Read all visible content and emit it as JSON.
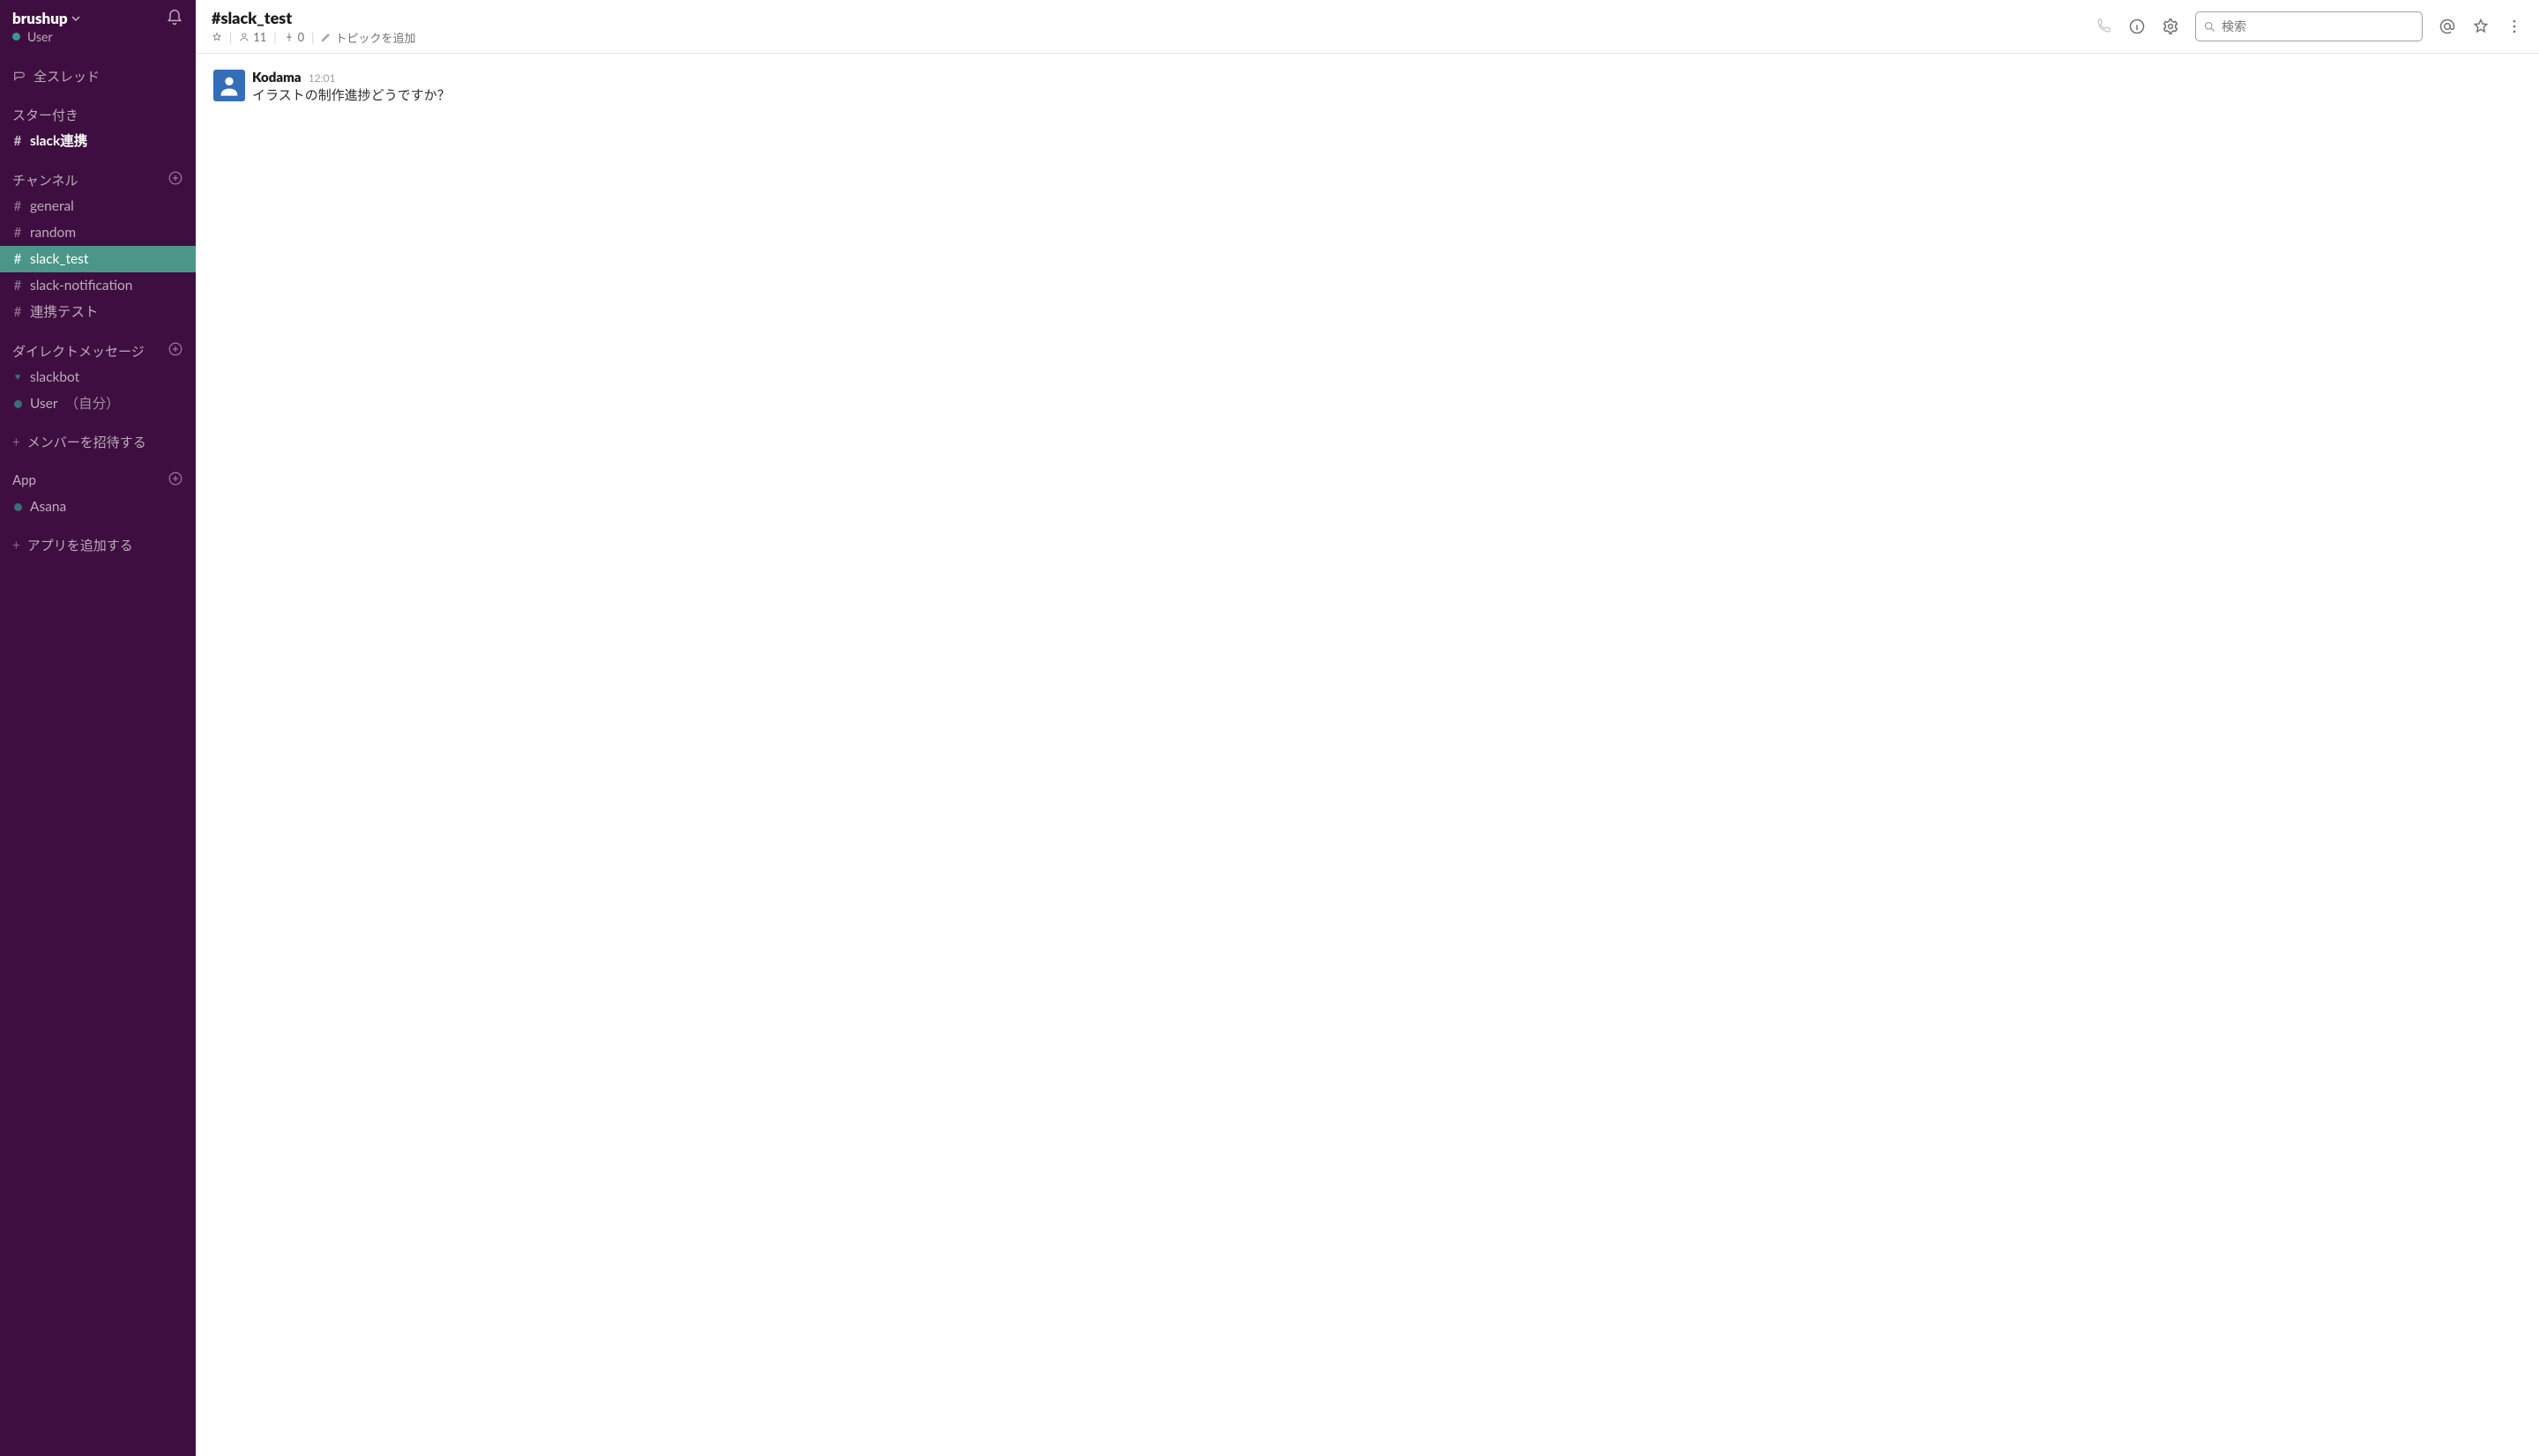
{
  "workspace": {
    "name": "brushup",
    "user_name": "User"
  },
  "sidebar": {
    "all_threads": "全スレッド",
    "starred_heading": "スター付き",
    "starred_items": [
      {
        "prefix": "#",
        "label": "slack連携",
        "bold": true
      }
    ],
    "channels_heading": "チャンネル",
    "channels": [
      {
        "prefix": "#",
        "label": "general"
      },
      {
        "prefix": "#",
        "label": "random"
      },
      {
        "prefix": "#",
        "label": "slack_test",
        "active": true
      },
      {
        "prefix": "#",
        "label": "slack-notification"
      },
      {
        "prefix": "#",
        "label": "連携テスト"
      }
    ],
    "dm_heading": "ダイレクトメッセージ",
    "dms": [
      {
        "type": "heart",
        "label": "slackbot"
      },
      {
        "type": "presence",
        "label": "User",
        "suffix": "（自分）"
      }
    ],
    "invite_label": "メンバーを招待する",
    "apps_heading": "App",
    "apps": [
      {
        "label": "Asana"
      }
    ],
    "add_app_label": "アプリを追加する"
  },
  "channel_header": {
    "name": "#slack_test",
    "members": "11",
    "pins": "0",
    "topic_placeholder": "トピックを追加"
  },
  "search": {
    "placeholder": "検索"
  },
  "messages": [
    {
      "sender": "Kodama",
      "time": "12:01",
      "text": "イラストの制作進捗どうですか？"
    }
  ]
}
